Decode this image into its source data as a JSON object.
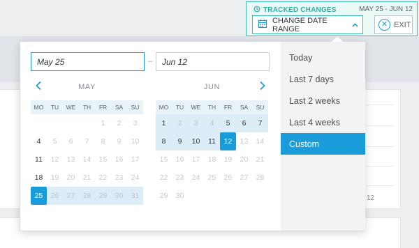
{
  "header": {
    "tracked_label": "TRACKED CHANGES",
    "tracked_range": "MAY 25 - JUN 12",
    "change_date_range_label": "CHANGE DATE RANGE",
    "exit_label": "EXIT",
    "accent_color": "#39c0b0"
  },
  "date_inputs": {
    "start_value": "May 25",
    "end_value": "Jun 12",
    "separator": "–"
  },
  "calendars": [
    {
      "month": "MAY",
      "weekdays": [
        "MO",
        "TU",
        "WE",
        "TH",
        "FR",
        "SA",
        "SU"
      ],
      "weeks": [
        [
          "",
          "",
          "",
          "",
          "1",
          "2",
          "3"
        ],
        [
          "4",
          "5",
          "6",
          "7",
          "8",
          "9",
          "10"
        ],
        [
          "11",
          "12",
          "13",
          "14",
          "15",
          "16",
          "17"
        ],
        [
          "18",
          "19",
          "20",
          "21",
          "22",
          "23",
          "24"
        ],
        [
          "25",
          "26",
          "27",
          "28",
          "29",
          "30",
          "31"
        ]
      ]
    },
    {
      "month": "JUN",
      "weekdays": [
        "MO",
        "TU",
        "WE",
        "TH",
        "FR",
        "SA",
        "SU"
      ],
      "weeks": [
        [
          "1",
          "2",
          "3",
          "4",
          "5",
          "6",
          "7"
        ],
        [
          "8",
          "9",
          "10",
          "11",
          "12",
          "13",
          "14"
        ],
        [
          "15",
          "16",
          "17",
          "18",
          "19",
          "20",
          "21"
        ],
        [
          "22",
          "23",
          "24",
          "25",
          "26",
          "27",
          "28"
        ],
        [
          "29",
          "30",
          "",
          "",
          "",
          "",
          ""
        ]
      ]
    }
  ],
  "presets": [
    {
      "label": "Today",
      "active": false
    },
    {
      "label": "Last 7 days",
      "active": false
    },
    {
      "label": "Last 2 weeks",
      "active": false
    },
    {
      "label": "Last 4 weeks",
      "active": false
    },
    {
      "label": "Custom",
      "active": true
    }
  ],
  "background": {
    "fragment_text": "12"
  },
  "colors": {
    "selected": "#1a9cdb",
    "range": "#dcedf7",
    "preset_panel": "#f1f3f5"
  }
}
